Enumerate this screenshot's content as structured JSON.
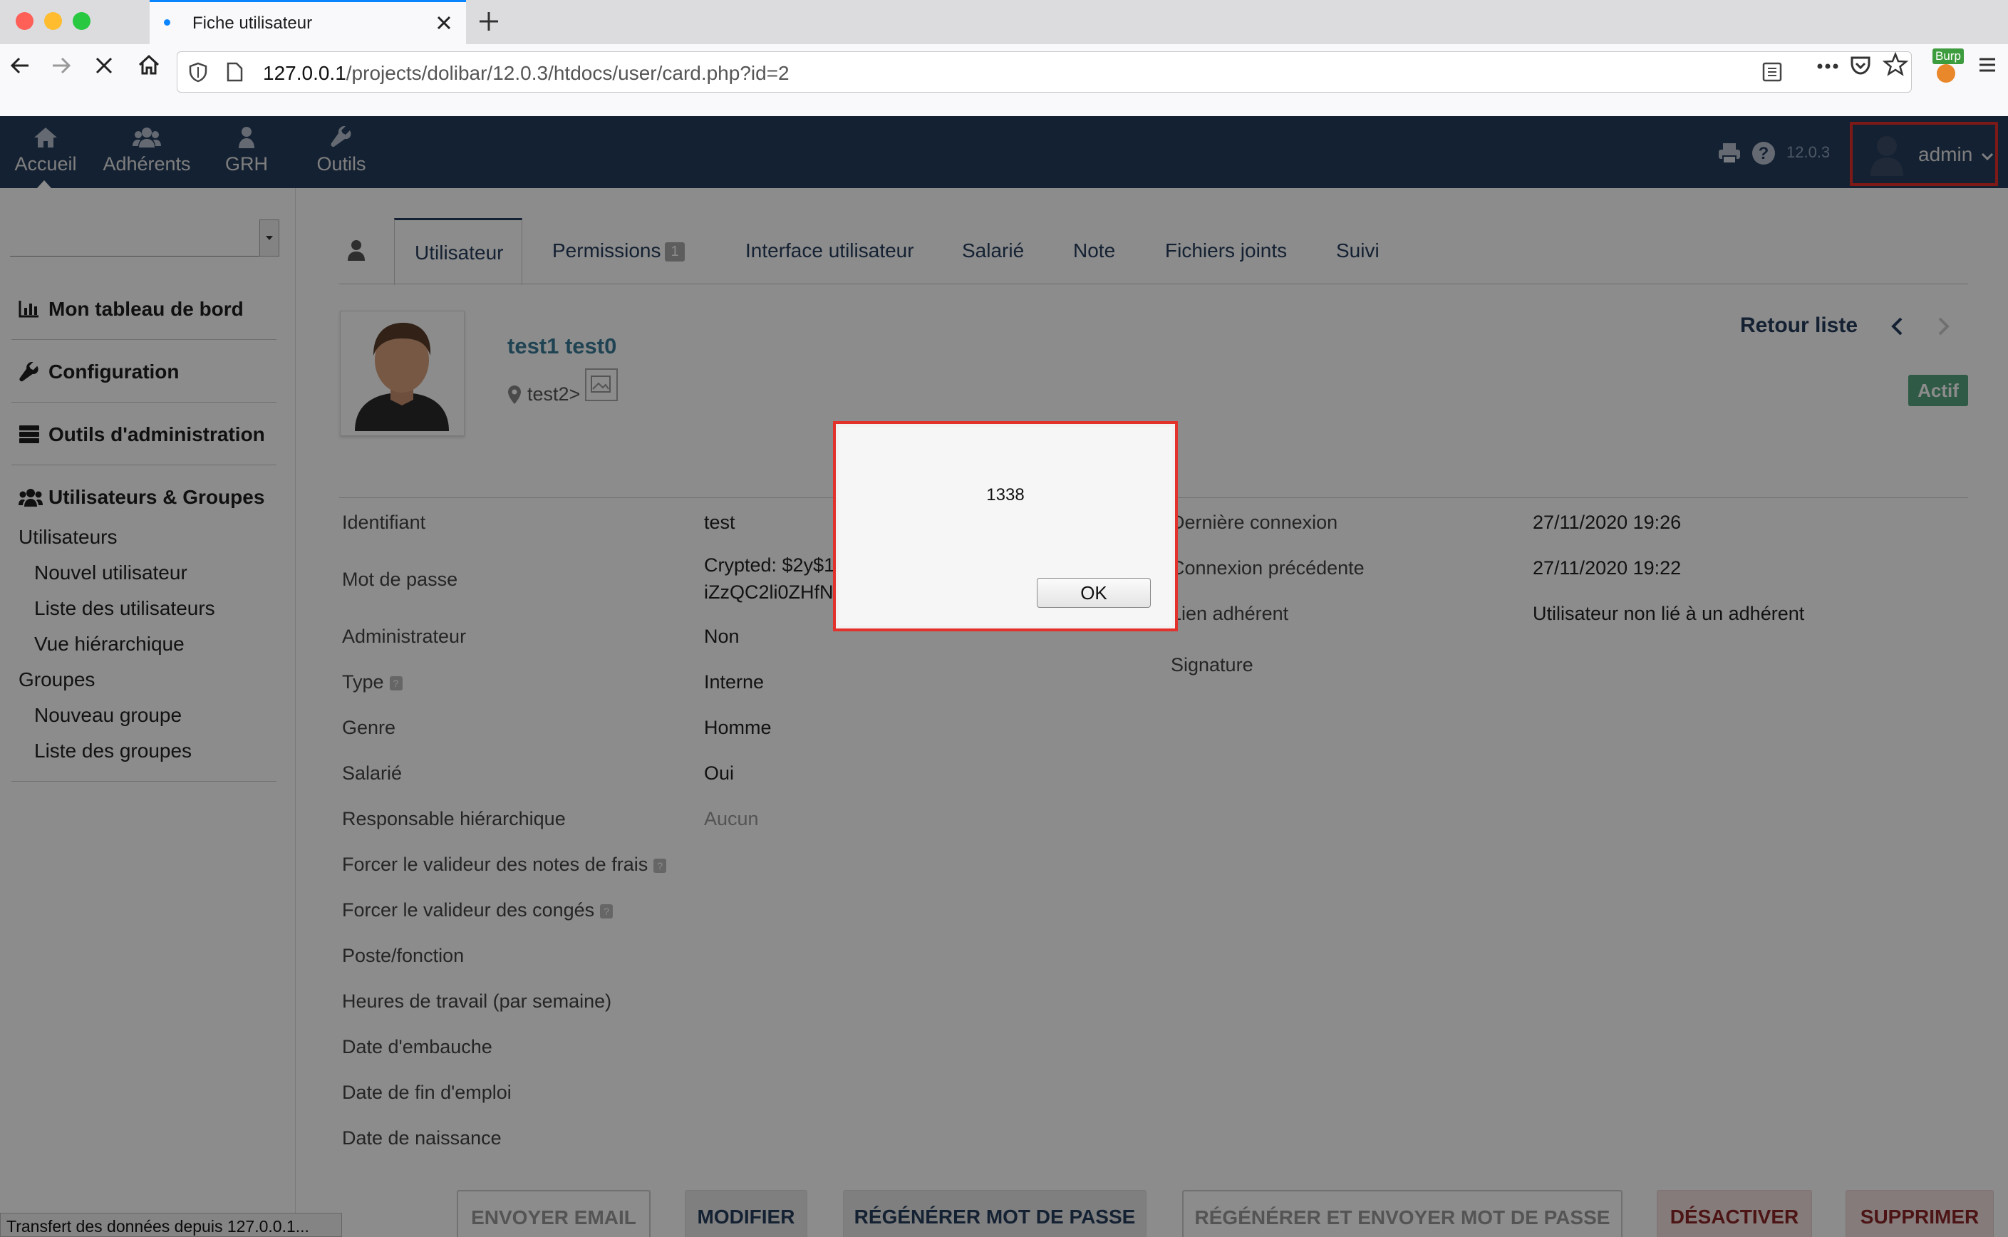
{
  "browser": {
    "tab_title": "Fiche utilisateur",
    "url_host": "127.0.0.1",
    "url_path": "/projects/dolibar/12.0.3/htdocs/user/card.php?id=2",
    "burp_label": "Burp",
    "status_text": "Transfert des données depuis 127.0.0.1..."
  },
  "topmenu": {
    "items": [
      {
        "label": "Accueil",
        "icon": "home-icon"
      },
      {
        "label": "Adhérents",
        "icon": "members-icon"
      },
      {
        "label": "GRH",
        "icon": "hr-icon"
      },
      {
        "label": "Outils",
        "icon": "wrench-icon"
      }
    ],
    "version": "12.0.3",
    "user": "admin"
  },
  "sidebar": {
    "sections": [
      {
        "label": "Mon tableau de bord",
        "icon": "chart-icon"
      },
      {
        "label": "Configuration",
        "icon": "wrench-icon"
      },
      {
        "label": "Outils d'administration",
        "icon": "server-icon"
      },
      {
        "label": "Utilisateurs & Groupes",
        "icon": "users-icon"
      }
    ],
    "users_title": "Utilisateurs",
    "users_links": [
      "Nouvel utilisateur",
      "Liste des utilisateurs",
      "Vue hiérarchique"
    ],
    "groups_title": "Groupes",
    "groups_links": [
      "Nouveau groupe",
      "Liste des groupes"
    ]
  },
  "tabs": [
    {
      "label": "Utilisateur"
    },
    {
      "label": "Permissions",
      "badge": "1"
    },
    {
      "label": "Interface utilisateur"
    },
    {
      "label": "Salarié"
    },
    {
      "label": "Note"
    },
    {
      "label": "Fichiers joints"
    },
    {
      "label": "Suivi"
    }
  ],
  "user": {
    "fullname": "test1 test0",
    "location": "test2>",
    "back_link": "Retour liste",
    "status": "Actif"
  },
  "fields_left": [
    {
      "label": "Identifiant",
      "value": "test"
    },
    {
      "label": "Mot de passe",
      "value": "Crypted: $2y$10$.I.h.UI.IFKo.WZ8GTOOunaduir",
      "value2": "iZzQC2li0ZHfNwg783oyRFLog6"
    },
    {
      "label": "Administrateur",
      "value": "Non"
    },
    {
      "label": "Type",
      "value": "Interne"
    },
    {
      "label": "Genre",
      "value": "Homme"
    },
    {
      "label": "Salarié",
      "value": "Oui"
    },
    {
      "label": "Responsable hiérarchique",
      "value": "Aucun"
    },
    {
      "label": "Forcer le valideur des notes de frais",
      "value": ""
    },
    {
      "label": "Forcer le valideur des congés",
      "value": ""
    },
    {
      "label": "Poste/fonction",
      "value": ""
    },
    {
      "label": "Heures de travail (par semaine)",
      "value": ""
    },
    {
      "label": "Date d'embauche",
      "value": ""
    },
    {
      "label": "Date de fin d'emploi",
      "value": ""
    },
    {
      "label": "Date de naissance",
      "value": ""
    }
  ],
  "fields_right": [
    {
      "label": "Dernière connexion",
      "value": "27/11/2020 19:26"
    },
    {
      "label": "Connexion précédente",
      "value": "27/11/2020 19:22"
    },
    {
      "label": "Lien adhérent",
      "value": "Utilisateur non lié à un adhérent"
    },
    {
      "label": "Signature",
      "value": ""
    }
  ],
  "actions": {
    "send_email": "ENVOYER EMAIL",
    "modify": "MODIFIER",
    "regen_password": "RÉGÉNÉRER MOT DE PASSE",
    "regen_send_password": "RÉGÉNÉRER ET ENVOYER MOT DE PASSE",
    "deactivate": "DÉSACTIVER",
    "delete": "SUPPRIMER"
  },
  "dialog": {
    "message": "1338",
    "ok_label": "OK"
  },
  "colors": {
    "topmenu_bg": "#263c5c",
    "highlight_border": "#e3312b",
    "status_active": "#55a580"
  }
}
